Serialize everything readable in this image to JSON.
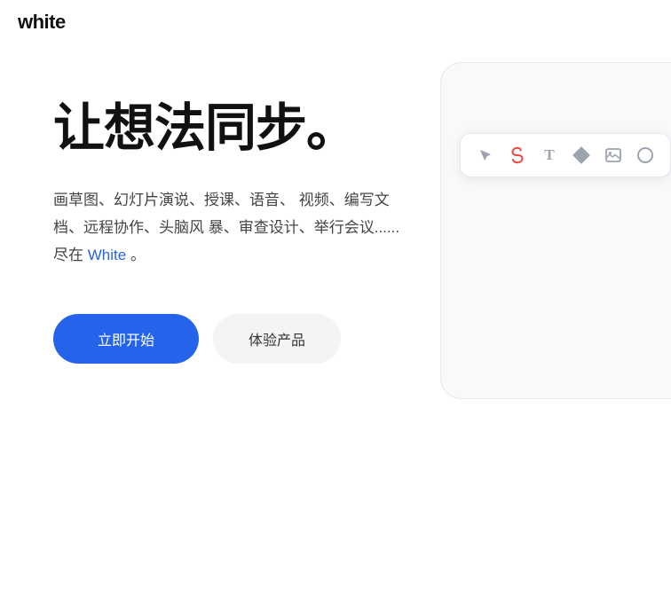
{
  "header": {
    "logo": "white"
  },
  "hero": {
    "title": "让想法同步。",
    "description_line1": "画草图、幻灯片演说、授课、语音、",
    "description_line2": "视频、编写文档、远程协作、头脑风",
    "description_line3": "暴、审查设计、举行会议...... 尽在",
    "description_highlight": "White",
    "description_suffix": "。",
    "btn_primary": "立即开始",
    "btn_secondary": "体验产品"
  },
  "toolbar": {
    "icons": [
      "arrow",
      "swirl",
      "text",
      "diamond",
      "image",
      "circle"
    ]
  },
  "colors": {
    "primary_blue": "#2563eb",
    "text_dark": "#111111",
    "text_gray": "#444444",
    "highlight_blue": "#2563eb",
    "swirl_red": "#ef4444"
  }
}
